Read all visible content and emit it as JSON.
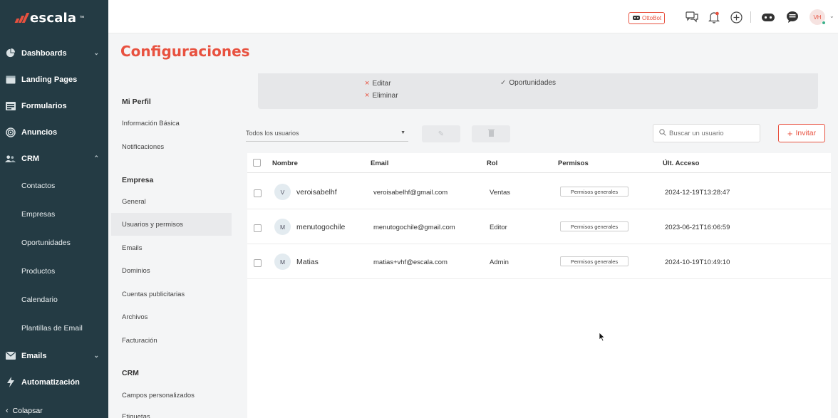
{
  "brand": {
    "name": "escala",
    "tm": "™",
    "accent": "#e8513f",
    "sidebar_bg": "#243b44"
  },
  "sidebar": {
    "items": [
      {
        "label": "Dashboards",
        "icon": "pie-chart-icon",
        "has_chevron": true
      },
      {
        "label": "Landing Pages",
        "icon": "browser-window-icon",
        "has_chevron": false
      },
      {
        "label": "Formularios",
        "icon": "form-icon",
        "has_chevron": false
      },
      {
        "label": "Anuncios",
        "icon": "target-icon",
        "has_chevron": false
      },
      {
        "label": "CRM",
        "icon": "users-icon",
        "has_chevron": true,
        "expanded": true
      }
    ],
    "crm_subitems": [
      "Contactos",
      "Empresas",
      "Oportunidades",
      "Productos",
      "Calendario",
      "Plantillas de Email"
    ],
    "bottom_items": [
      {
        "label": "Emails",
        "icon": "envelope-icon",
        "has_chevron": true
      },
      {
        "label": "Automatización",
        "icon": "lightning-icon",
        "has_chevron": false
      }
    ],
    "collapse_label": "Colapsar"
  },
  "topbar": {
    "ottobot_label": "OttoBot",
    "icons": [
      "chat-bubbles-icon",
      "bell-icon",
      "plus-circle-icon",
      "gamepad-icon",
      "support-chat-icon"
    ],
    "avatar_initials": "VH"
  },
  "page": {
    "title": "Configuraciones"
  },
  "settings_menu": {
    "sections": [
      {
        "heading": "Mi Perfil",
        "items": [
          "Información Básica",
          "Notificaciones"
        ]
      },
      {
        "heading": "Empresa",
        "items": [
          "General",
          "Usuarios y permisos",
          "Emails",
          "Dominios",
          "Cuentas publicitarias",
          "Archivos",
          "Facturación"
        ]
      },
      {
        "heading": "CRM",
        "items": [
          "Campos personalizados",
          "Etiquetas"
        ]
      }
    ],
    "active_item": "Usuarios y permisos"
  },
  "permissions_panel": {
    "denied": [
      "Editar",
      "Eliminar"
    ],
    "granted": [
      "Oportunidades"
    ]
  },
  "toolbar": {
    "filter_value": "Todos los usuarios",
    "search_placeholder": "Buscar un usuario",
    "invite_label": "Invitar"
  },
  "table": {
    "columns": [
      "Nombre",
      "Email",
      "Rol",
      "Permisos",
      "Últ. Acceso"
    ],
    "rows": [
      {
        "initial": "V",
        "name": "veroisabelhf",
        "email": "veroisabelhf@gmail.com",
        "role": "Ventas",
        "permissions": "Permisos generales",
        "last_access": "2024-12-19T13:28:47"
      },
      {
        "initial": "M",
        "name": "menutogochile",
        "email": "menutogochile@gmail.com",
        "role": "Editor",
        "permissions": "Permisos generales",
        "last_access": "2023-06-21T16:06:59"
      },
      {
        "initial": "M",
        "name": "Matias",
        "email": "matias+vhf@escala.com",
        "role": "Admin",
        "permissions": "Permisos generales",
        "last_access": "2024-10-19T10:49:10"
      }
    ]
  }
}
